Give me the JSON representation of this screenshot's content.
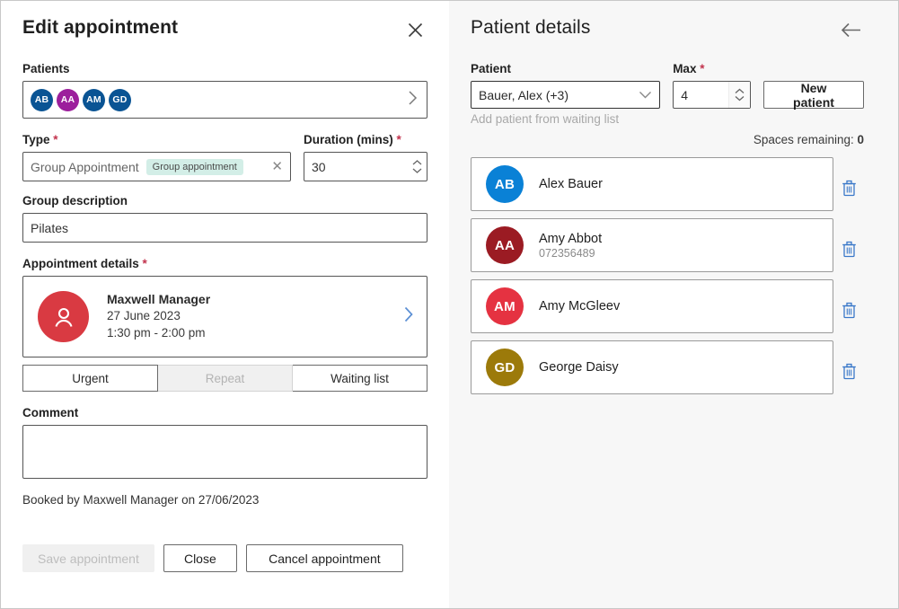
{
  "left": {
    "title": "Edit appointment",
    "close_icon": "close-icon",
    "patients_label": "Patients",
    "patient_avatars": [
      {
        "initials": "AB",
        "color": "#0a5494"
      },
      {
        "initials": "AA",
        "color": "#9c1f9c"
      },
      {
        "initials": "AM",
        "color": "#0a5494"
      },
      {
        "initials": "GD",
        "color": "#0a5494"
      }
    ],
    "type_label": "Type",
    "type_required": "*",
    "type_value": "Group Appointment",
    "type_chip": "Group appointment",
    "type_clear_icon": "clear-icon",
    "duration_label": "Duration (mins)",
    "duration_required": "*",
    "duration_value": "30",
    "group_description_label": "Group description",
    "group_description_value": "Pilates",
    "appointment_details_label": "Appointment details",
    "appointment_details_required": "*",
    "appointment": {
      "avatar_icon": "person-icon",
      "avatar_color": "#d93a42",
      "name": "Maxwell Manager",
      "date": "27 June 2023",
      "time": "1:30 pm - 2:00 pm",
      "chevron_icon": "chevron-right-icon"
    },
    "toggles": [
      {
        "label": "Urgent",
        "disabled": false
      },
      {
        "label": "Repeat",
        "disabled": true
      },
      {
        "label": "Waiting list",
        "disabled": false
      }
    ],
    "comment_label": "Comment",
    "comment_value": "",
    "booked_by": "Booked by Maxwell Manager on 27/06/2023",
    "buttons": [
      {
        "label": "Save appointment",
        "disabled": true
      },
      {
        "label": "Close",
        "disabled": false
      },
      {
        "label": "Cancel appointment",
        "disabled": false
      }
    ]
  },
  "right": {
    "title": "Patient details",
    "back_icon": "arrow-left-icon",
    "patient_label": "Patient",
    "patient_value": "Bauer, Alex (+3)",
    "patient_chevron_icon": "chevron-down-icon",
    "waiting_list_hint": "Add patient from waiting list",
    "max_label": "Max",
    "max_required": "*",
    "max_value": "4",
    "new_patient_label": "New patient",
    "spaces_remaining_label": "Spaces remaining:",
    "spaces_remaining_value": "0",
    "patients": [
      {
        "initials": "AB",
        "color": "#0a81d6",
        "name": "Alex Bauer",
        "sub": ""
      },
      {
        "initials": "AA",
        "color": "#9b1b23",
        "name": "Amy Abbot",
        "sub": "072356489"
      },
      {
        "initials": "AM",
        "color": "#e53241",
        "name": "Amy McGleev",
        "sub": ""
      },
      {
        "initials": "GD",
        "color": "#9c7a0a",
        "name": "George Daisy",
        "sub": ""
      }
    ],
    "delete_icon": "trash-icon"
  },
  "colors": {
    "accent_blue": "#3a78c9",
    "required_red": "#c2334d",
    "chip_bg": "#d3eee7",
    "panel_bg": "#f7f7f7"
  }
}
